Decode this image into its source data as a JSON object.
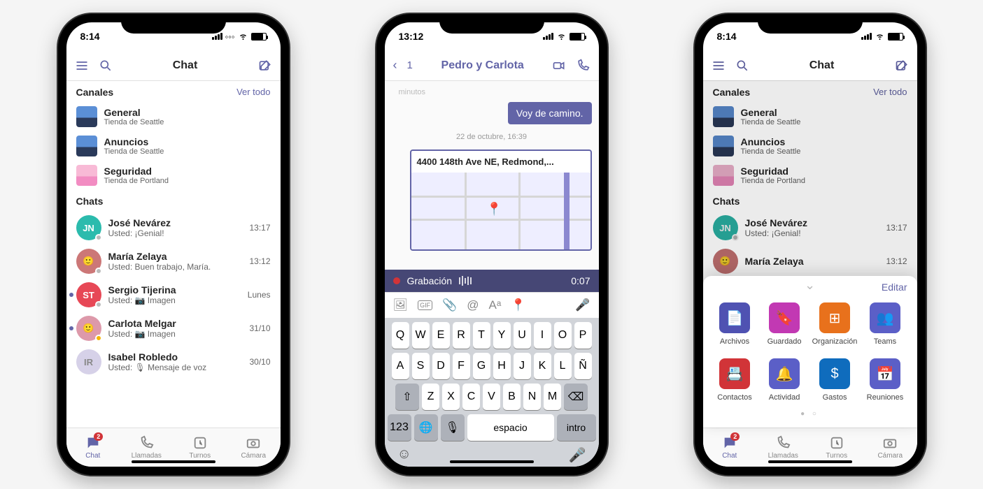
{
  "phone1": {
    "status_time": "8:14",
    "header_title": "Chat",
    "sections": {
      "channels": {
        "title": "Canales",
        "link": "Ver todo"
      },
      "chats": {
        "title": "Chats"
      }
    },
    "channels": [
      {
        "name": "General",
        "sub": "Tienda de Seattle"
      },
      {
        "name": "Anuncios",
        "sub": "Tienda de Seattle"
      },
      {
        "name": "Seguridad",
        "sub": "Tienda de Portland"
      }
    ],
    "chats": [
      {
        "initials": "JN",
        "color": "#2bbbad",
        "name": "José Nevárez",
        "sub": "Usted: ¡Genial!",
        "time": "13:17",
        "presence": "#bbb"
      },
      {
        "initials": "",
        "color": "#c77",
        "name": "María Zelaya",
        "sub": "Usted: Buen trabajo, María.",
        "time": "13:12",
        "presence": "#bbb",
        "photo": true
      },
      {
        "initials": "ST",
        "color": "#e74856",
        "name": "Sergio Tijerina",
        "sub": "Usted: 📷 Imagen",
        "time": "Lunes",
        "presence": "#bbb",
        "unread": true
      },
      {
        "initials": "",
        "color": "#d9a",
        "name": "Carlota Melgar",
        "sub": "Usted: 📷 Imagen",
        "time": "31/10",
        "presence": "#f7b500",
        "photo": true,
        "unread": true
      },
      {
        "initials": "IR",
        "color": "#d6d1e8",
        "name": "Isabel Robledo",
        "sub": "Usted: 🎙 Mensaje de voz",
        "time": "30/10",
        "presence": "",
        "textc": "#888"
      }
    ],
    "tabs": [
      {
        "label": "Chat",
        "badge": "2"
      },
      {
        "label": "Llamadas"
      },
      {
        "label": "Turnos"
      },
      {
        "label": "Cámara"
      }
    ]
  },
  "phone2": {
    "status_time": "13:12",
    "back": "1",
    "title": "Pedro y Carlota",
    "ghost": "minutos",
    "bubble": "Voy de camino.",
    "divider": "22 de octubre, 16:39",
    "address": "4400 148th Ave NE, Redmond,...",
    "rec_label": "Grabación",
    "rec_time": "0:07",
    "keys_r1": [
      "Q",
      "W",
      "E",
      "R",
      "T",
      "Y",
      "U",
      "I",
      "O",
      "P"
    ],
    "keys_r2": [
      "A",
      "S",
      "D",
      "F",
      "G",
      "H",
      "J",
      "K",
      "L",
      "Ñ"
    ],
    "keys_r3": [
      "Z",
      "X",
      "C",
      "V",
      "B",
      "N",
      "M"
    ],
    "key_123": "123",
    "key_space": "espacio",
    "key_intro": "intro"
  },
  "phone3": {
    "status_time": "8:14",
    "edit": "Editar",
    "apps": [
      {
        "label": "Archivos",
        "color": "#4f52b2",
        "glyph": "file"
      },
      {
        "label": "Guardado",
        "color": "#c239b3",
        "glyph": "bookmark"
      },
      {
        "label": "Organización",
        "color": "#e8711c",
        "glyph": "org"
      },
      {
        "label": "Teams",
        "color": "#5b5fc7",
        "glyph": "teams"
      },
      {
        "label": "Contactos",
        "color": "#d13438",
        "glyph": "contacts"
      },
      {
        "label": "Actividad",
        "color": "#5b5fc7",
        "glyph": "bell"
      },
      {
        "label": "Gastos",
        "color": "#0f6cbd",
        "glyph": "dollar"
      },
      {
        "label": "Reuniones",
        "color": "#5b5fc7",
        "glyph": "calendar"
      }
    ]
  }
}
